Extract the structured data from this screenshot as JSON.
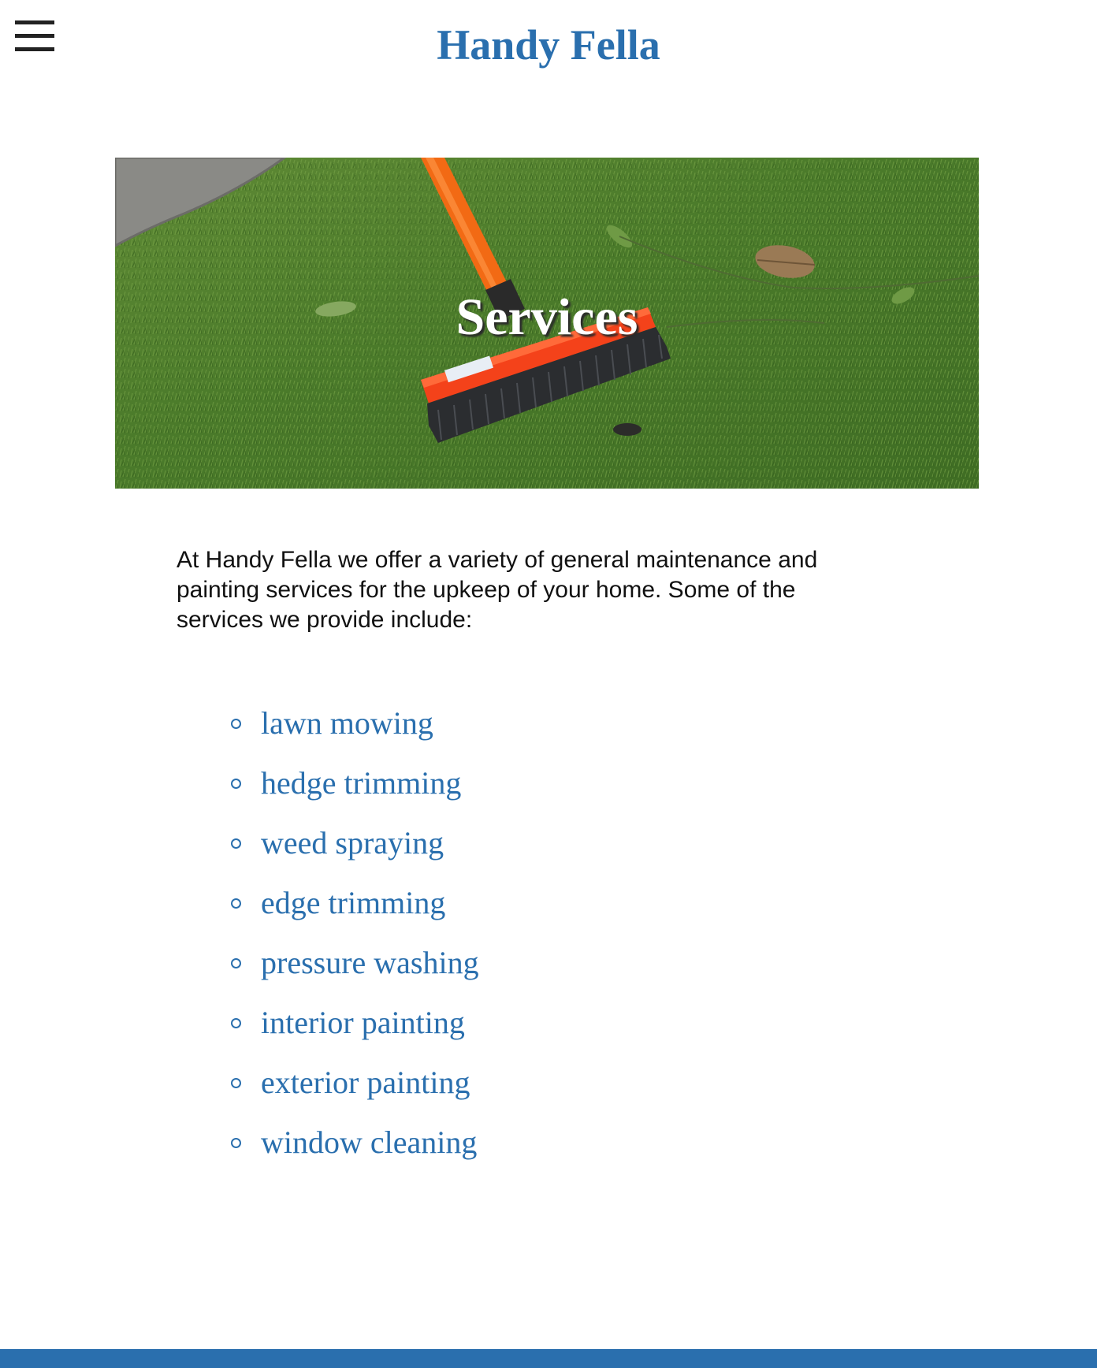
{
  "header": {
    "menu_icon": "hamburger-menu-icon",
    "site_title": "Handy Fella"
  },
  "hero": {
    "title": "Services",
    "image": "broom-on-grass-photo"
  },
  "intro": {
    "text": "At Handy Fella we offer a variety of general maintenance and painting services for the upkeep of your home. Some of the services we provide include:"
  },
  "services": [
    "lawn mowing",
    "hedge trimming",
    "weed spraying",
    "edge trimming",
    "pressure washing",
    "interior painting",
    "exterior painting",
    "window cleaning"
  ],
  "colors": {
    "brand_blue": "#2a6fae",
    "text": "#111111",
    "background": "#ffffff"
  }
}
